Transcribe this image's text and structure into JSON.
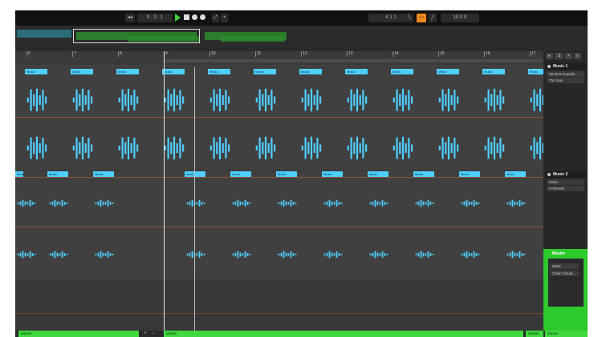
{
  "transport": {
    "position": "9 . 3 . 1",
    "right_counter": "10   0   0",
    "left_group": "4   1   1"
  },
  "ruler": {
    "bars": [
      "6",
      "7",
      "8",
      "9",
      "10",
      "11",
      "12",
      "13",
      "14",
      "15",
      "16",
      "17"
    ]
  },
  "tracks": [
    {
      "name": "Music 1",
      "clip_label": "Music",
      "devices": [
        "Window Equaliz...",
        "TM Gain"
      ]
    },
    {
      "name": "Music 2",
      "clip_label": "Music",
      "devices": [
        "Mixer",
        "X-Reverb"
      ]
    }
  ],
  "master": {
    "name": "Master",
    "devices": [
      "Mixer",
      "Chain Visual..."
    ]
  },
  "bottom": {
    "left_label": "Master",
    "mid_label": "Master",
    "right_label": "Master",
    "master_strip": "Master"
  },
  "colors": {
    "clip": "#4fcfff",
    "master": "#2dc92d",
    "accent": "#f08a1e"
  }
}
